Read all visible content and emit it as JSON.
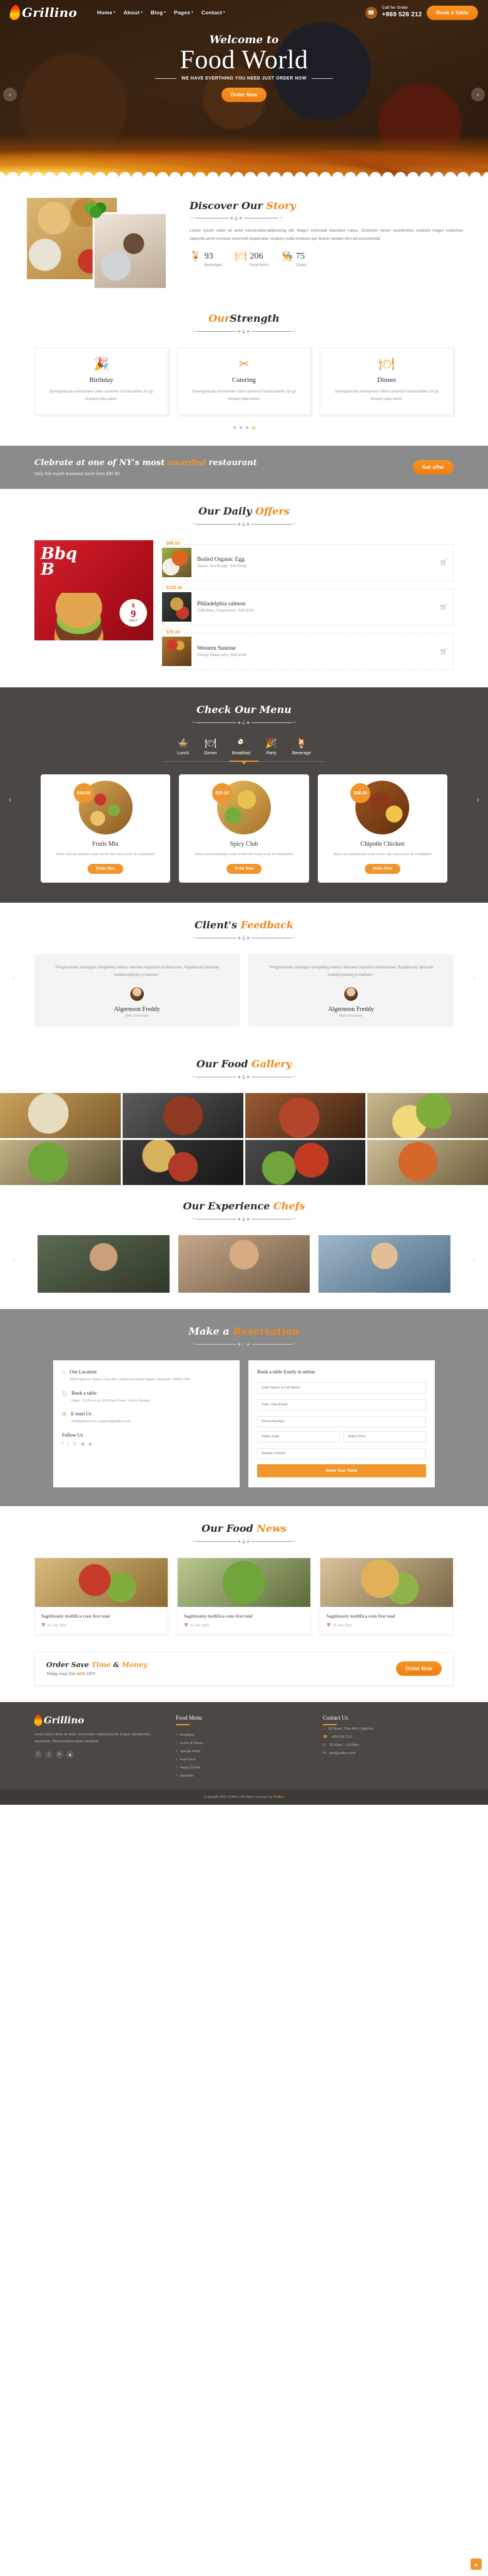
{
  "header": {
    "brand": "Grillino",
    "nav": [
      {
        "label": "Home",
        "caret": "▾"
      },
      {
        "label": "About",
        "caret": "▾"
      },
      {
        "label": "Blog",
        "caret": "▾"
      },
      {
        "label": "Pages",
        "caret": "▾"
      },
      {
        "label": "Contact",
        "caret": "▾"
      }
    ],
    "call_label": "Call for Order",
    "call_number": "+869 526 212",
    "book_button": "Book a Table",
    "phone_icon": "phone-icon"
  },
  "hero": {
    "welcome": "Welcome to",
    "title": "Food World",
    "subtitle": "WE HAVE EVERTHING YOU NEED JUST ORDER NOW",
    "cta": "Order Now",
    "prev_icon": "chevron-left-icon",
    "next_icon": "chevron-right-icon"
  },
  "story": {
    "title_a": "Discover Our ",
    "title_b": "Story",
    "paragraph": "Lorem ipsum dolor sit amet consectetur,adipisicing elit. Magni commodi doloribus natus. Distinctio rerum repellendus incidunt magni molestias sapiente,amet cumque commodi aspernatur corporis nulla tempore qui facere veniam rem ea assumenda!",
    "stats": [
      {
        "icon": "beverage-icon",
        "glyph": "🍹",
        "value": "93",
        "label": "Beverages"
      },
      {
        "icon": "food-items-icon",
        "glyph": "🍽",
        "value": "206",
        "label": "Food Items"
      },
      {
        "icon": "cook-icon",
        "glyph": "👨‍🍳",
        "value": "75",
        "label": "Cooks"
      }
    ]
  },
  "strength": {
    "title_a": "Our",
    "title_b": "Strength",
    "cards": [
      {
        "icon": "party-popper-icon",
        "glyph": "🎉",
        "title": "Birthday",
        "text": "Synergistically envisioneer client centered functionalities for go forward data world."
      },
      {
        "icon": "crossed-cutlery-icon",
        "glyph": "✂",
        "title": "Catering",
        "text": "Synergistically envisioneer client centered functionalities for go forward data world."
      },
      {
        "icon": "cloche-icon",
        "glyph": "🍽",
        "title": "Dinner",
        "text": "Synergistically envisioneer client centered functionalities for go forward data world."
      }
    ],
    "dots": 4,
    "active_dot": 3
  },
  "promo": {
    "head_a": "Clebrate at one of NY's most ",
    "head_accent": "awarded",
    "head_b": " restaurant",
    "sub": "Only this month business lunch from $30.90",
    "button": "Get offer"
  },
  "offers": {
    "title_a": "Our Daily ",
    "title_b": "Offers",
    "banner": {
      "line1": "Bbq",
      "line2": "B",
      "currency": "$",
      "value": "9",
      "per": "ONLY"
    },
    "items": [
      {
        "price": "$89.00",
        "name": "Boiled Organic Egg",
        "desc": "Sauce, Hot Burger, Soft Drink",
        "cart_icon": "cart-icon"
      },
      {
        "price": "$125.00",
        "name": "Philadelphia salmon",
        "desc": "Chilli bites, Chomchom, Soft Drink",
        "cart_icon": "cart-icon"
      },
      {
        "price": "$79.00",
        "name": "Western Sunrise",
        "desc": "Chingri Malai curry, Soft Drink",
        "cart_icon": "cart-icon"
      }
    ]
  },
  "menu": {
    "title": "Check Our Menu",
    "tabs": [
      {
        "icon": "lunch-icon",
        "glyph": "🍲",
        "label": "Lunch",
        "active": false
      },
      {
        "icon": "cloche-icon",
        "glyph": "🍽",
        "label": "Dinner",
        "active": false
      },
      {
        "icon": "breakfast-icon",
        "glyph": "🍳",
        "label": "Breakfast",
        "active": false
      },
      {
        "icon": "party-icon",
        "glyph": "🎉",
        "label": "Party",
        "active": true
      },
      {
        "icon": "beverage-icon",
        "glyph": "🍹",
        "label": "Beverage",
        "active": false
      }
    ],
    "cards": [
      {
        "price": "$49.99",
        "title": "Fruits Mix",
        "text": "Moon sed perspiciatis unde omnis iste natus error sit voluptatem",
        "button": "Order Now"
      },
      {
        "price": "$29.00",
        "title": "Spicy Club",
        "text": "Moon sed perspiciatis unde omnis iste natus error sit voluptatem",
        "button": "Order Now"
      },
      {
        "price": "$36.00",
        "title": "Chipotle Chicken",
        "text": "Moon sed perspiciatis unde omnis iste natus error sit voluptatem",
        "button": "Order Now"
      }
    ],
    "prev_icon": "chevron-left-icon",
    "next_icon": "chevron-right-icon"
  },
  "feedback": {
    "title_a": "Client's ",
    "title_b": "Feedback",
    "items": [
      {
        "quote": "\"Progressively strategize compelling metrics whereas impactful architectures. Rapidiously fabricate multidisciplinary e-markets.\"",
        "name": "Algernoon Freddy",
        "role": "Web Developer"
      },
      {
        "quote": "\"Progressively strategize compelling metrics whereas impactful architectures. Rapidiously fabricate multidisciplinary e-markets.\"",
        "name": "Algernoon Freddy",
        "role": "Web Developer"
      }
    ],
    "prev_icon": "chevron-left-icon",
    "next_icon": "chevron-right-icon"
  },
  "gallery": {
    "title_a": "Our Food ",
    "title_b": "Gallery",
    "cells": [
      "tacos-photo",
      "ribs-photo",
      "bacon-photo",
      "salad-eggs-photo",
      "greens-photo",
      "sauces-photo",
      "steak-tray-photo",
      "pasta-photo"
    ]
  },
  "chefs": {
    "title_a": "Our Experience ",
    "title_b": "Chefs",
    "items": [
      "chef-one-photo",
      "chef-two-photo",
      "chef-three-photo"
    ],
    "prev_icon": "chevron-left-icon",
    "next_icon": "chevron-right-icon"
  },
  "reservation": {
    "title_a": "Make a ",
    "title_b": "Reservation",
    "info": [
      {
        "icon": "location-icon",
        "glyph": "⌂",
        "title": "Our Location",
        "desc": "2036 Hanover Street, Palo Alto, California United States, Newyork, 59000 USA"
      },
      {
        "icon": "calendar-icon",
        "glyph": "☷",
        "title": "Book a table",
        "desc": "Open : 10.00 am to 10.00 pm Close : Every Sunday"
      },
      {
        "icon": "mail-icon",
        "glyph": "✉",
        "title": "E-mail Us",
        "desc": "info@grillino.com support@grillino.com"
      }
    ],
    "follow_title": "Follow Us",
    "socials": [
      "facebook-icon",
      "twitter-icon",
      "linkedin-icon",
      "instagram-icon",
      "youtube-icon"
    ],
    "form_title": "Book a table Easily in online",
    "fields": [
      {
        "placeholder": "Enter Name & Full Name"
      },
      {
        "placeholder": "Enter Your Email"
      },
      {
        "placeholder": "Phone Number"
      },
      {
        "placeholder": "Select Date"
      },
      {
        "placeholder": "Select Time"
      },
      {
        "placeholder": "Number Person"
      }
    ],
    "submit": "Book Your Table"
  },
  "news": {
    "title_a": "Our Food ",
    "title_b": "News",
    "items": [
      {
        "title": "Sagittiously mollifica cons first total",
        "date": "21 July 2021",
        "date_icon": "calendar-icon"
      },
      {
        "title": "Sagittiously mollifica cons first total",
        "date": "21 July 2021",
        "date_icon": "calendar-icon"
      },
      {
        "title": "Sagittiously mollifica cons first total",
        "date": "21 July 2021",
        "date_icon": "calendar-icon"
      }
    ]
  },
  "order_strip": {
    "head_a": "Order Save ",
    "head_accent1": "Time",
    "head_mid": " & ",
    "head_accent2": "Money",
    "sub_a": "Today now Get ",
    "sub_accent": "40%",
    "sub_b": " OFF",
    "button": "Order Now"
  },
  "footer": {
    "brand": "Grillino",
    "about": "Lorem ipsum dolor sit amet, consectetur adipisicing elit. Eaque repudiandae asperiores. Necessitatibus quasi similique.",
    "socials": [
      "facebook-icon",
      "twitter-icon",
      "linkedin-icon",
      "instagram-icon"
    ],
    "menu_title": "Food Menu",
    "menu_links": [
      "Breakfast",
      "Lunch & Dinner",
      "Special Items",
      "Fast Food",
      "Happy Drinks",
      "Desserts"
    ],
    "contact_title": "Contact Us",
    "contact_items": [
      {
        "icon": "location-icon",
        "glyph": "⌂",
        "text": "59 Street, Palo Alto California"
      },
      {
        "icon": "phone-icon",
        "glyph": "☎",
        "text": "+869 526 212"
      },
      {
        "icon": "clock-icon",
        "glyph": "◴",
        "text": "10.00am - 10.00pm"
      },
      {
        "icon": "mail-icon",
        "glyph": "✉",
        "text": "info@grillino.com"
      }
    ],
    "copyright_a": "Copyright 2021 Grillino. All rights reserved by ",
    "copyright_accent": "Grillino",
    "to_top_icon": "arrow-up-icon"
  }
}
